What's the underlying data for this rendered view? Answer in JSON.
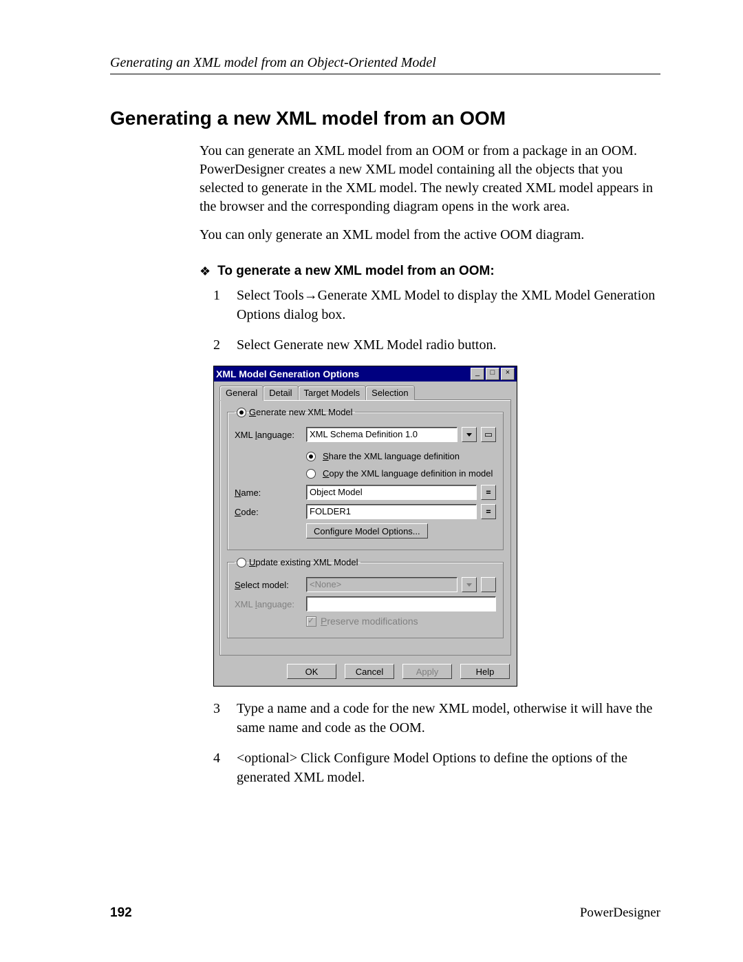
{
  "header": "Generating an XML model from an Object-Oriented Model",
  "title": "Generating a new XML model from an OOM",
  "intro1": "You can generate an XML model from an OOM or from a package in an OOM. PowerDesigner creates a new XML model containing all the objects that you selected to generate in the XML model. The newly created XML model appears in the browser and the corresponding diagram opens in the work area.",
  "intro2": "You can only generate an XML model from the active OOM diagram.",
  "proc_title": "To generate a new XML model from an OOM:",
  "steps": {
    "s1": "Select Tools→Generate XML Model to display the XML Model Generation Options dialog box.",
    "s2": "Select Generate new XML Model radio button.",
    "s3": "Type a name and a code for the new XML model, otherwise it will have the same name and code as the OOM.",
    "s4": "<optional> Click Configure Model Options to define the options of the generated XML model."
  },
  "dialog": {
    "title": "XML Model Generation Options",
    "tabs": [
      "General",
      "Detail",
      "Target Models",
      "Selection"
    ],
    "grp_generate_legend_pre": "G",
    "grp_generate_legend_post": "enerate new XML Model",
    "xml_lang_label_pre": "XML ",
    "xml_lang_label_u": "l",
    "xml_lang_label_post": "anguage:",
    "xml_lang_value": "XML Schema Definition 1.0",
    "share_pre": "S",
    "share_post": "hare the XML language definition",
    "copy_pre": "C",
    "copy_post": "opy the XML language definition in model",
    "name_label_u": "N",
    "name_label_post": "ame:",
    "name_value": "Object Model",
    "code_label_u": "C",
    "code_label_post": "ode:",
    "code_value": "FOLDER1",
    "configure_btn": "Configure Model Options...",
    "grp_update_legend_pre": "U",
    "grp_update_legend_post": "pdate existing XML Model",
    "select_model_label_u": "S",
    "select_model_label_post": "elect model:",
    "select_model_value": "<None>",
    "xml_lang2_label_pre": "XML ",
    "xml_lang2_label_u": "l",
    "xml_lang2_label_post": "anguage:",
    "preserve_pre": "P",
    "preserve_post": "reserve modifications",
    "buttons": {
      "ok": "OK",
      "cancel": "Cancel",
      "apply": "Apply",
      "help": "Help"
    }
  },
  "footer": {
    "page": "192",
    "brand": "PowerDesigner"
  }
}
